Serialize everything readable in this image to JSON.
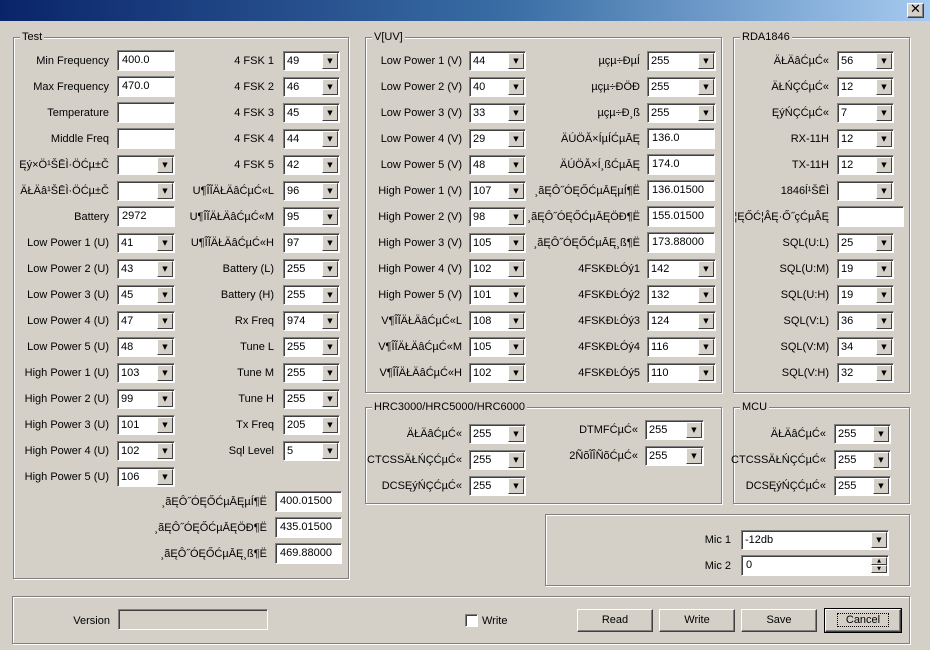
{
  "window": {
    "close_glyph": "✕"
  },
  "test": {
    "title": "Test",
    "left_rows": [
      {
        "label": "Min Frequency",
        "type": "text",
        "value": "400.0"
      },
      {
        "label": "Max Frequency",
        "type": "text",
        "value": "470.0"
      },
      {
        "label": "Temperature",
        "type": "text",
        "value": ""
      },
      {
        "label": "Middle Freq",
        "type": "text",
        "value": ""
      },
      {
        "label": "Ęý×Ö¹ŠĒÌ·ÖĆµ±Č",
        "type": "combo",
        "value": ""
      },
      {
        "label": "ÄŁÄâ¹ŠĒÌ·ÖĆµ±Č",
        "type": "combo",
        "value": ""
      },
      {
        "label": "Battery",
        "type": "text",
        "value": "2972"
      },
      {
        "label": "Low Power 1 (U)",
        "type": "combo",
        "value": "41"
      },
      {
        "label": "Low Power 2 (U)",
        "type": "combo",
        "value": "43"
      },
      {
        "label": "Low Power 3 (U)",
        "type": "combo",
        "value": "45"
      },
      {
        "label": "Low Power 4 (U)",
        "type": "combo",
        "value": "47"
      },
      {
        "label": "Low Power 5 (U)",
        "type": "combo",
        "value": "48"
      },
      {
        "label": "High Power 1 (U)",
        "type": "combo",
        "value": "103"
      },
      {
        "label": "High Power 2 (U)",
        "type": "combo",
        "value": "99"
      },
      {
        "label": "High Power 3 (U)",
        "type": "combo",
        "value": "101"
      },
      {
        "label": "High Power 4 (U)",
        "type": "combo",
        "value": "102"
      },
      {
        "label": "High Power 5 (U)",
        "type": "combo",
        "value": "106"
      }
    ],
    "right_rows": [
      {
        "label": "4 FSK 1",
        "value": "49"
      },
      {
        "label": "4 FSK 2",
        "value": "46"
      },
      {
        "label": "4 FSK 3",
        "value": "45"
      },
      {
        "label": "4 FSK 4",
        "value": "44"
      },
      {
        "label": "4 FSK 5",
        "value": "42"
      },
      {
        "label": "U¶ÎĨÄŁÄâĆµĆ«L",
        "value": "96"
      },
      {
        "label": "U¶ÎĨÄŁÄâĆµĆ«M",
        "value": "95"
      },
      {
        "label": "U¶ÎĨÄŁÄâĆµĆ«H",
        "value": "97"
      },
      {
        "label": "Battery (L)",
        "value": "255"
      },
      {
        "label": "Battery (H)",
        "value": "255"
      },
      {
        "label": "Rx Freq",
        "value": "974"
      },
      {
        "label": "Tune L",
        "value": "255"
      },
      {
        "label": "Tune M",
        "value": "255"
      },
      {
        "label": "Tune H",
        "value": "255"
      },
      {
        "label": "Tx Freq",
        "value": "205"
      },
      {
        "label": "Sql Level",
        "value": "5"
      }
    ],
    "bottom_rows": [
      {
        "label": "¸ãĘÔ˝ÓĘŐĆµĀĘµÍ¶Ë",
        "value": "400.01500"
      },
      {
        "label": "¸ãĘÔ˝ÓĘŐĆµĀĘÖĐ¶Ë",
        "value": "435.01500"
      },
      {
        "label": "¸ãĘÔ˝ÓĘŐĆµĀĘ¸ß¶Ë",
        "value": "469.88000"
      }
    ]
  },
  "v": {
    "title": "V[UV]",
    "left_rows": [
      {
        "label": "Low Power 1 (V)",
        "value": "44"
      },
      {
        "label": "Low Power 2 (V)",
        "value": "40"
      },
      {
        "label": "Low Power 3 (V)",
        "value": "33"
      },
      {
        "label": "Low Power 4 (V)",
        "value": "29"
      },
      {
        "label": "Low Power 5 (V)",
        "value": "48"
      },
      {
        "label": "High Power 1 (V)",
        "value": "107"
      },
      {
        "label": "High Power 2 (V)",
        "value": "98"
      },
      {
        "label": "High Power 3 (V)",
        "value": "105"
      },
      {
        "label": "High Power 4 (V)",
        "value": "102"
      },
      {
        "label": "High Power 5 (V)",
        "value": "101"
      },
      {
        "label": "V¶ÎĨÄŁÄâĆµĆ«L",
        "value": "108"
      },
      {
        "label": "V¶ÎĨÄŁÄâĆµĆ«M",
        "value": "105"
      },
      {
        "label": "V¶ÎĨÄŁÄâĆµĆ«H",
        "value": "102"
      }
    ],
    "right_rows": [
      {
        "label": "µçµ÷ĐµÍ",
        "type": "combo",
        "value": "255"
      },
      {
        "label": "µçµ÷ĐÖÐ",
        "type": "combo",
        "value": "255"
      },
      {
        "label": "µçµ÷Đ¸ß",
        "type": "combo",
        "value": "255"
      },
      {
        "label": "ÄÚÖĂ×ÍµÍĆµĀĘ",
        "type": "text",
        "value": "136.0"
      },
      {
        "label": "ÄÚÖĂ×Í¸ßĆµĀĘ",
        "type": "text",
        "value": "174.0"
      },
      {
        "label": "¸ãĘÔ˝ÓĘŐĆµĀĘµÍ¶Ë",
        "type": "text",
        "value": "136.01500"
      },
      {
        "label": "¸ãĘÔ˝ÓĘŐĆµĀĘÖĐ¶Ë",
        "type": "text",
        "value": "155.01500"
      },
      {
        "label": "¸ãĘÔ˝ÓĘŐĆµĀĘ¸ß¶Ë",
        "type": "text",
        "value": "173.88000"
      },
      {
        "label": "4FSKĐĿÓý1",
        "type": "combo",
        "value": "142"
      },
      {
        "label": "4FSKĐĿÓý2",
        "type": "combo",
        "value": "132"
      },
      {
        "label": "4FSKĐĿÓý3",
        "type": "combo",
        "value": "124"
      },
      {
        "label": "4FSKĐĿÓý4",
        "type": "combo",
        "value": "116"
      },
      {
        "label": "4FSKĐĿÓý5",
        "type": "combo",
        "value": "110"
      }
    ]
  },
  "rda": {
    "title": "RDA1846",
    "rows": [
      {
        "label": "ÄŁÄâĆµĆ«",
        "type": "combo",
        "value": "56"
      },
      {
        "label": "ÄŁŃÇĆµĆ«",
        "type": "combo",
        "value": "12"
      },
      {
        "label": "ĘýŃÇĆµĆ«",
        "type": "combo",
        "value": "7"
      },
      {
        "label": "RX-11H",
        "type": "combo",
        "value": "12"
      },
      {
        "label": "TX-11H",
        "type": "combo",
        "value": "12"
      },
      {
        "label": "1846ĺ¹ŠĒÌ",
        "type": "combo",
        "value": ""
      },
      {
        "label": "¦ĘŐĆ¦ÂĘ·Ő˝çĆµÂĘ",
        "type": "text",
        "value": ""
      },
      {
        "label": "SQL(U:L)",
        "type": "combo",
        "value": "25"
      },
      {
        "label": "SQL(U:M)",
        "type": "combo",
        "value": "19"
      },
      {
        "label": "SQL(U:H)",
        "type": "combo",
        "value": "19"
      },
      {
        "label": "SQL(V:L)",
        "type": "combo",
        "value": "36"
      },
      {
        "label": "SQL(V:M)",
        "type": "combo",
        "value": "34"
      },
      {
        "label": "SQL(V:H)",
        "type": "combo",
        "value": "32"
      }
    ]
  },
  "hrc": {
    "title": "HRC3000/HRC5000/HRC6000",
    "left_rows": [
      {
        "label": "ÄŁÄâĆµĆ«",
        "value": "255"
      },
      {
        "label": "CTCSSÄŁŃÇĆµĆ«",
        "value": "255"
      },
      {
        "label": "DCSĘýŃÇĆµĆ«",
        "value": "255"
      }
    ],
    "right_rows": [
      {
        "label": "DTMFĆµĆ«",
        "value": "255"
      },
      {
        "label": "2ÑõĨÎÑõĆµĆ«",
        "value": "255"
      }
    ]
  },
  "mcu": {
    "title": "MCU",
    "rows": [
      {
        "label": "ÄŁÄâĆµĆ«",
        "value": "255"
      },
      {
        "label": "CTCSSÄŁŃÇĆµĆ«",
        "value": "255"
      },
      {
        "label": "DCSĘýŃÇĆµĆ«",
        "value": "255"
      }
    ]
  },
  "mic": {
    "mic1_label": "Mic 1",
    "mic1_value": "-12db",
    "mic2_label": "Mic 2",
    "mic2_value": "0"
  },
  "footer": {
    "version_label": "Version",
    "version_value": "",
    "write_checkbox_label": "Write",
    "buttons": [
      "Read",
      "Write",
      "Save",
      "Cancel"
    ]
  },
  "icons": {
    "arrow_down": "▼",
    "spin_up": "▲",
    "spin_down": "▼"
  }
}
